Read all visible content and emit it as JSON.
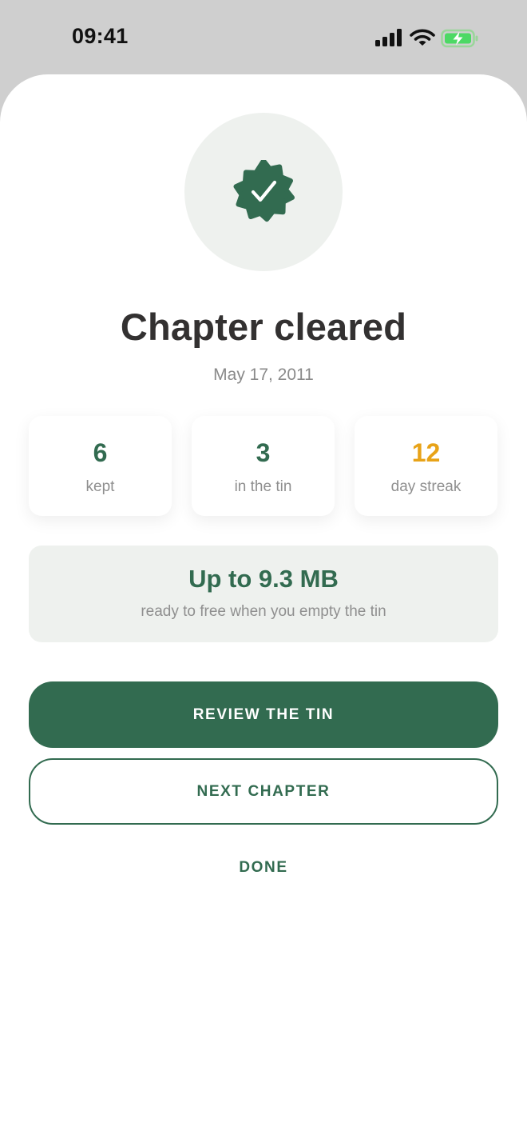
{
  "status_bar": {
    "time": "09:41",
    "icons": [
      "signal-icon",
      "wifi-icon",
      "battery-charging-icon"
    ]
  },
  "badge": {
    "icon": "verified-badge-check-icon"
  },
  "header": {
    "title": "Chapter cleared",
    "date": "May 17, 2011"
  },
  "stats": [
    {
      "value": "6",
      "label": "kept"
    },
    {
      "value": "3",
      "label": "in the tin"
    },
    {
      "value": "12",
      "label": "day streak"
    }
  ],
  "space": {
    "value": "Up to 9.3 MB",
    "note": "ready to free when you empty the tin"
  },
  "actions": {
    "primary_label": "REVIEW THE TIN",
    "secondary_label": "NEXT CHAPTER",
    "tertiary_label": "DONE"
  },
  "colors": {
    "accent": "#326b50",
    "streak": "#e8a318",
    "badge_bg": "#eef1ee",
    "battery_fill": "#4cd964"
  }
}
